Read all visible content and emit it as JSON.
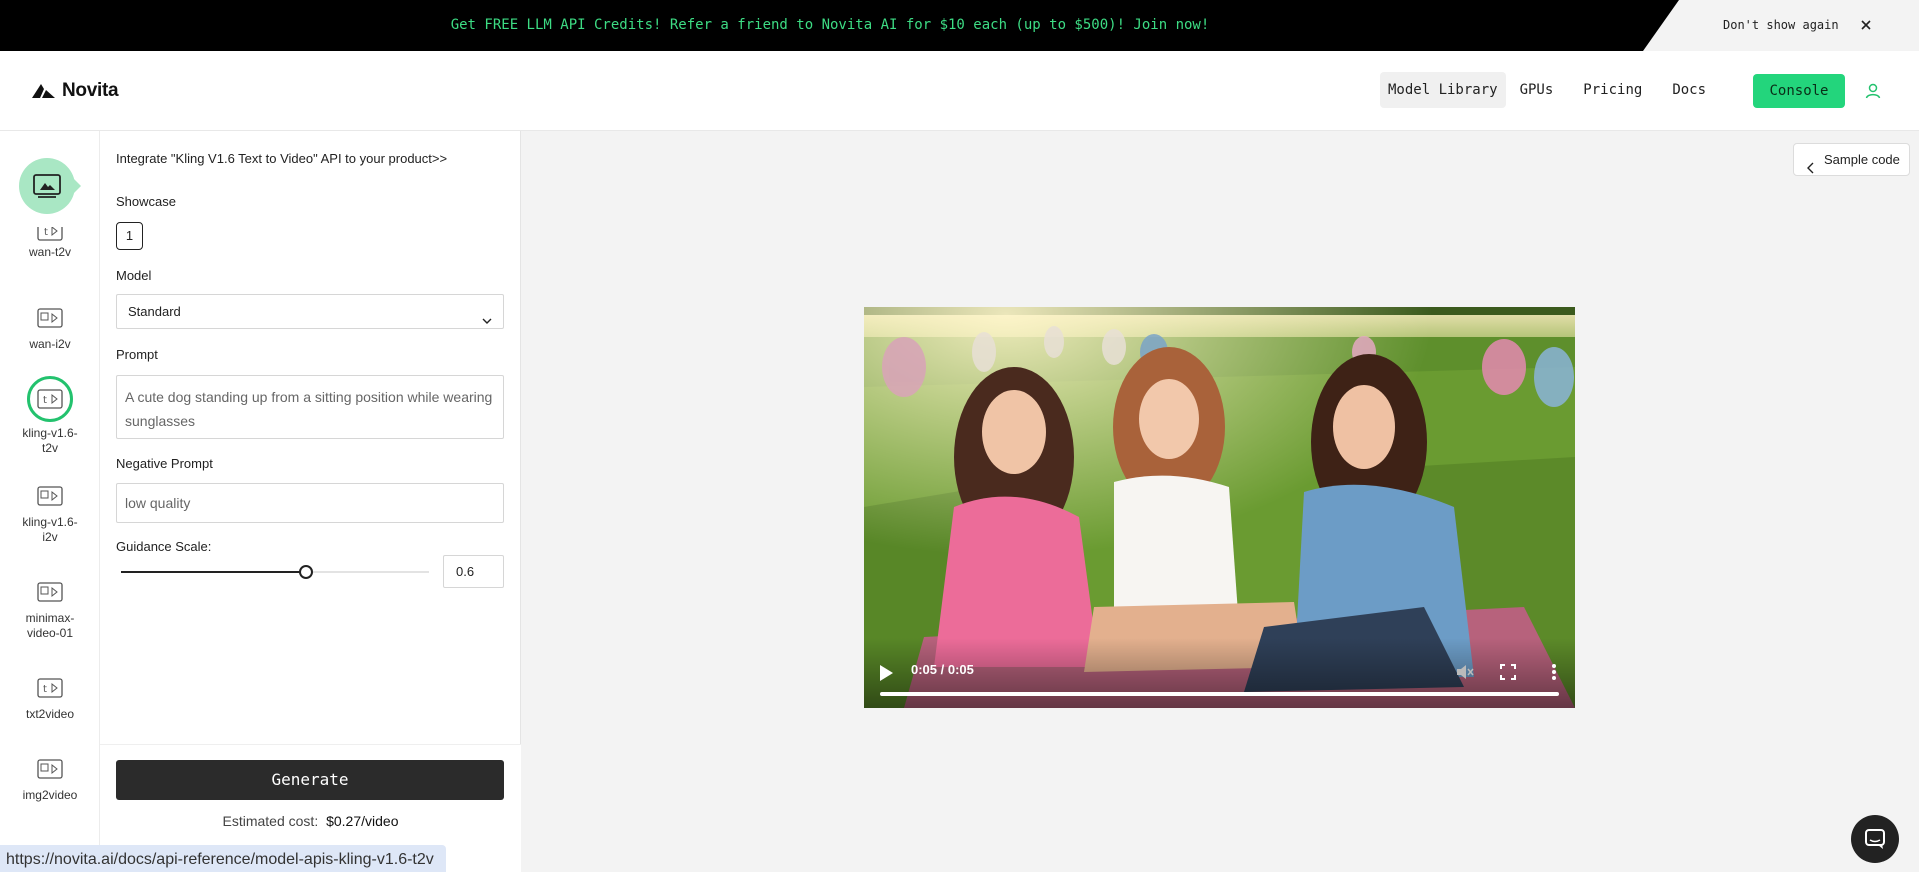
{
  "banner": {
    "promo_text": "Get FREE LLM API Credits! Refer a friend to Novita AI for $10 each (up to $500)! Join now!",
    "dont_show": "Don't show again"
  },
  "header": {
    "logo_text": "Novita",
    "nav": [
      {
        "label": "Model Library",
        "active": true
      },
      {
        "label": "GPUs"
      },
      {
        "label": "Pricing"
      },
      {
        "label": "Docs"
      }
    ],
    "console_label": "Console"
  },
  "rail": {
    "items": [
      {
        "label": "wan-t2v",
        "icon": "t2v-icon"
      },
      {
        "label": "wan-i2v",
        "icon": "i2v-icon"
      },
      {
        "label": "kling-v1.6-t2v",
        "icon": "t2v-icon",
        "active": true
      },
      {
        "label": "kling-v1.6-i2v",
        "icon": "i2v-icon"
      },
      {
        "label": "minimax-video-01",
        "icon": "i2v-icon"
      },
      {
        "label": "txt2video",
        "icon": "t2v-icon"
      },
      {
        "label": "img2video",
        "icon": "i2v-icon"
      }
    ]
  },
  "form": {
    "integrate_link": "Integrate \"Kling V1.6 Text to Video\" API to your product>>",
    "showcase_label": "Showcase",
    "showcase_item": "1",
    "model_label": "Model",
    "model_value": "Standard",
    "prompt_label": "Prompt",
    "prompt_value": "A cute dog standing up from a sitting position while wearing sunglasses",
    "negative_label": "Negative Prompt",
    "negative_value": "low quality",
    "guidance_label": "Guidance Scale:",
    "guidance_value": "0.6",
    "guidance_fraction": 0.6,
    "generate_label": "Generate",
    "cost_label": "Estimated cost:",
    "cost_value": "$0.27/video"
  },
  "main": {
    "sample_code_label": "Sample code",
    "video_time": "0:05 / 0:05",
    "video_progress": 1.0
  },
  "status_bar": {
    "url": "https://novita.ai/docs/api-reference/model-apis-kling-v1.6-t2v"
  },
  "colors": {
    "accent": "#23d57c",
    "banner_bg": "#000000",
    "banner_text": "#3ddc84",
    "primary_button": "#2b2b2b"
  }
}
